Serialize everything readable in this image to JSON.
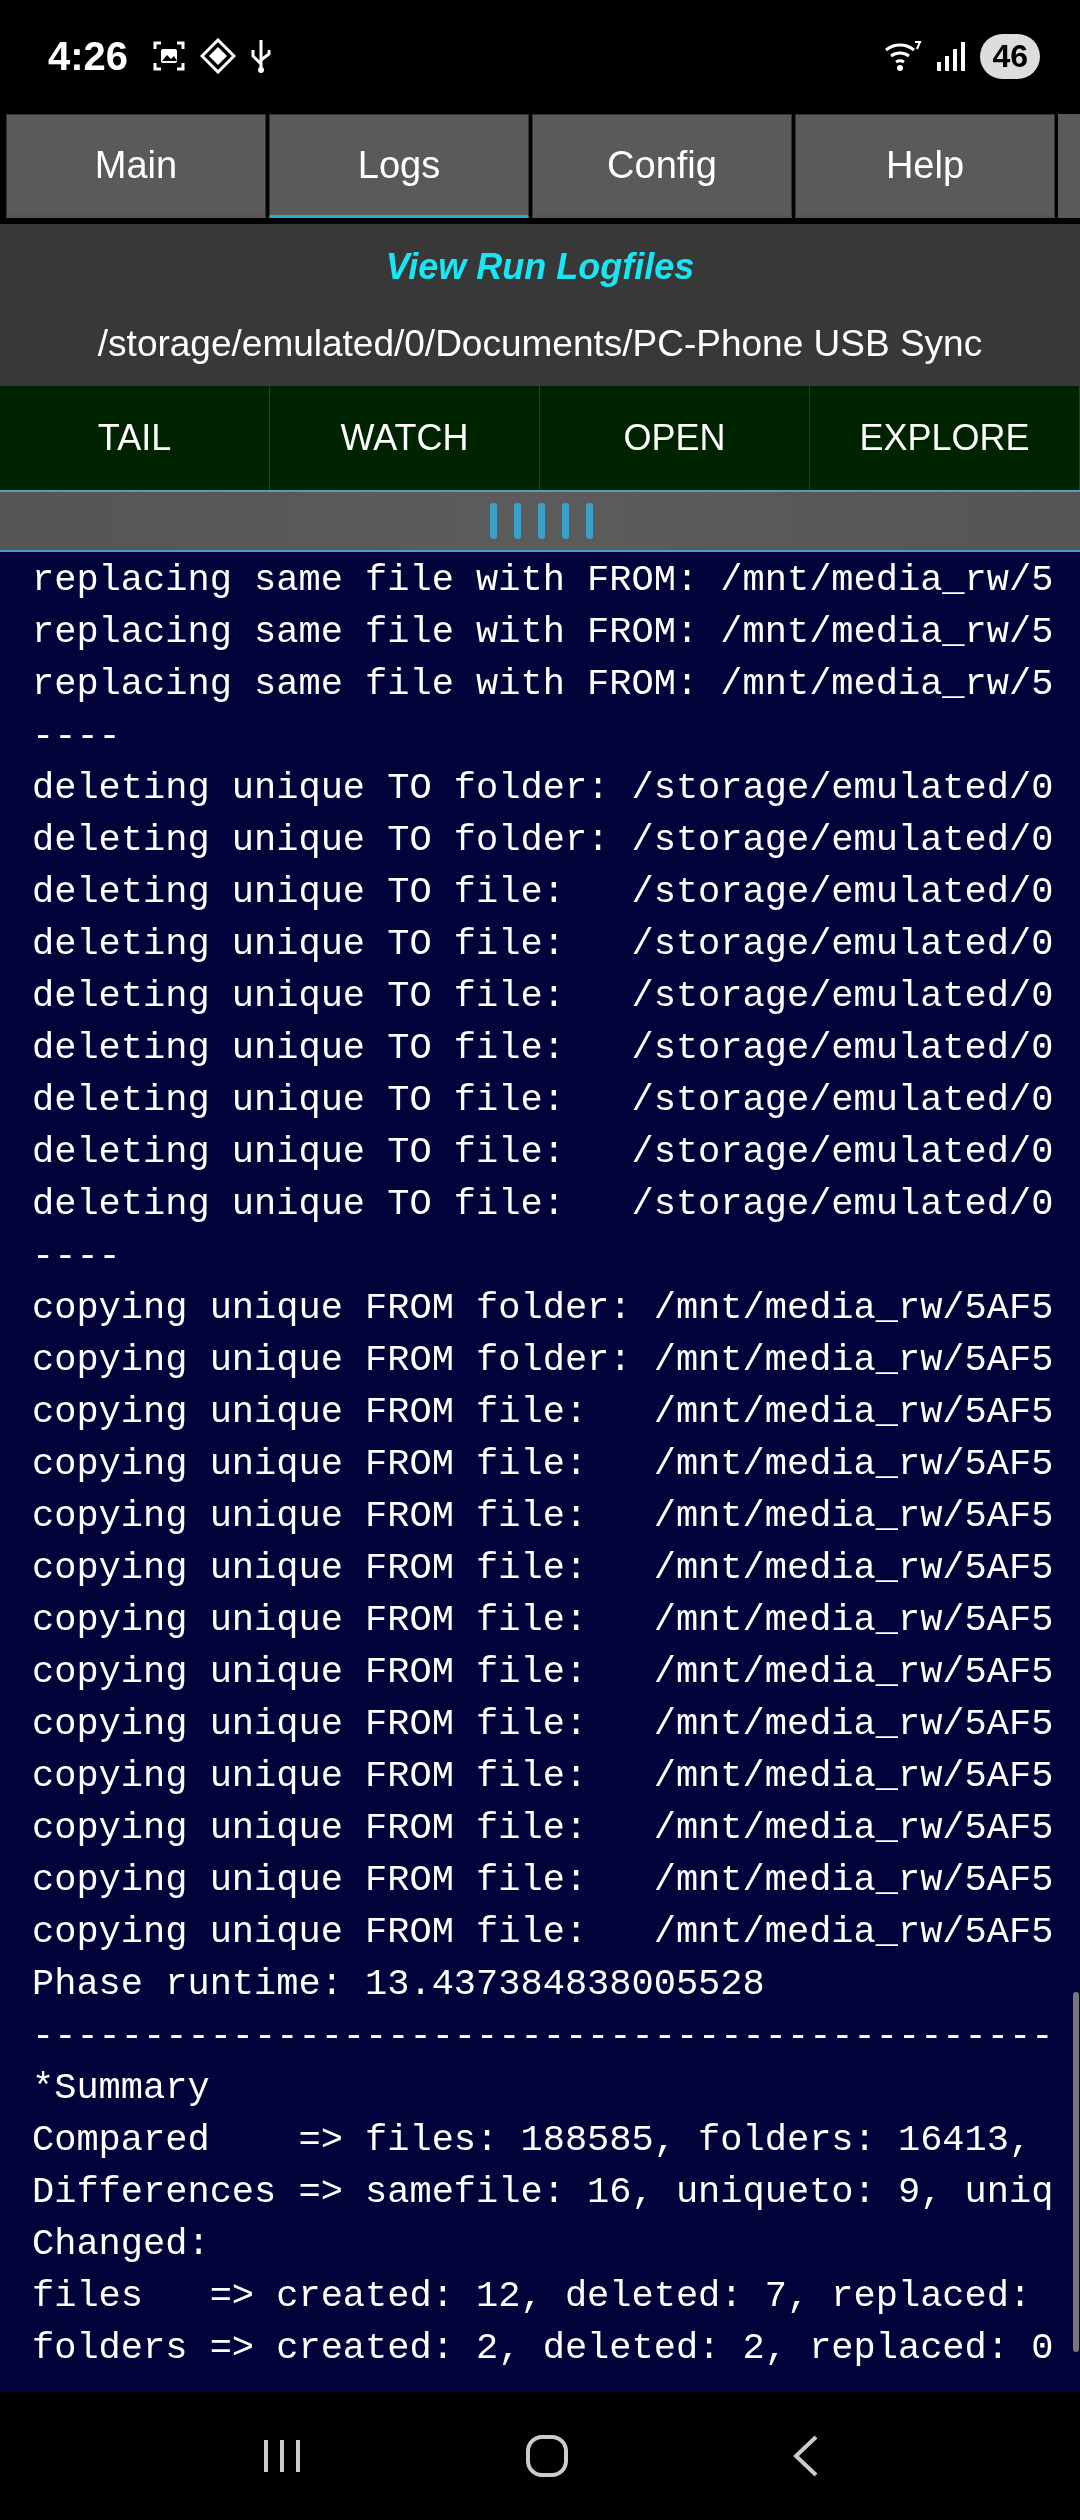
{
  "status_bar": {
    "time": "4:26",
    "battery": "46"
  },
  "tabs": [
    {
      "label": "Main",
      "selected": false
    },
    {
      "label": "Logs",
      "selected": true
    },
    {
      "label": "Config",
      "selected": false
    },
    {
      "label": "Help",
      "selected": false
    }
  ],
  "header": {
    "title": "View Run Logfiles",
    "path": "/storage/emulated/0/Documents/PC-Phone USB Sync"
  },
  "buttons": [
    "TAIL",
    "WATCH",
    "OPEN",
    "EXPLORE"
  ],
  "log_lines": [
    "replacing same file with FROM: /mnt/media_rw/5",
    "replacing same file with FROM: /mnt/media_rw/5",
    "replacing same file with FROM: /mnt/media_rw/5",
    "----",
    "deleting unique TO folder: /storage/emulated/0",
    "deleting unique TO folder: /storage/emulated/0",
    "deleting unique TO file:   /storage/emulated/0",
    "deleting unique TO file:   /storage/emulated/0",
    "deleting unique TO file:   /storage/emulated/0",
    "deleting unique TO file:   /storage/emulated/0",
    "deleting unique TO file:   /storage/emulated/0",
    "deleting unique TO file:   /storage/emulated/0",
    "deleting unique TO file:   /storage/emulated/0",
    "----",
    "copying unique FROM folder: /mnt/media_rw/5AF5",
    "copying unique FROM folder: /mnt/media_rw/5AF5",
    "copying unique FROM file:   /mnt/media_rw/5AF5",
    "copying unique FROM file:   /mnt/media_rw/5AF5",
    "copying unique FROM file:   /mnt/media_rw/5AF5",
    "copying unique FROM file:   /mnt/media_rw/5AF5",
    "copying unique FROM file:   /mnt/media_rw/5AF5",
    "copying unique FROM file:   /mnt/media_rw/5AF5",
    "copying unique FROM file:   /mnt/media_rw/5AF5",
    "copying unique FROM file:   /mnt/media_rw/5AF5",
    "copying unique FROM file:   /mnt/media_rw/5AF5",
    "copying unique FROM file:   /mnt/media_rw/5AF5",
    "copying unique FROM file:   /mnt/media_rw/5AF5",
    "Phase runtime: 13.437384838005528",
    "----------------------------------------------",
    "*Summary",
    "Compared    => files: 188585, folders: 16413,",
    "Differences => samefile: 16, uniqueto: 9, uniq",
    "Changed:",
    "files   => created: 12, deleted: 7, replaced:",
    "folders => created: 2, deleted: 2, replaced: 0"
  ]
}
